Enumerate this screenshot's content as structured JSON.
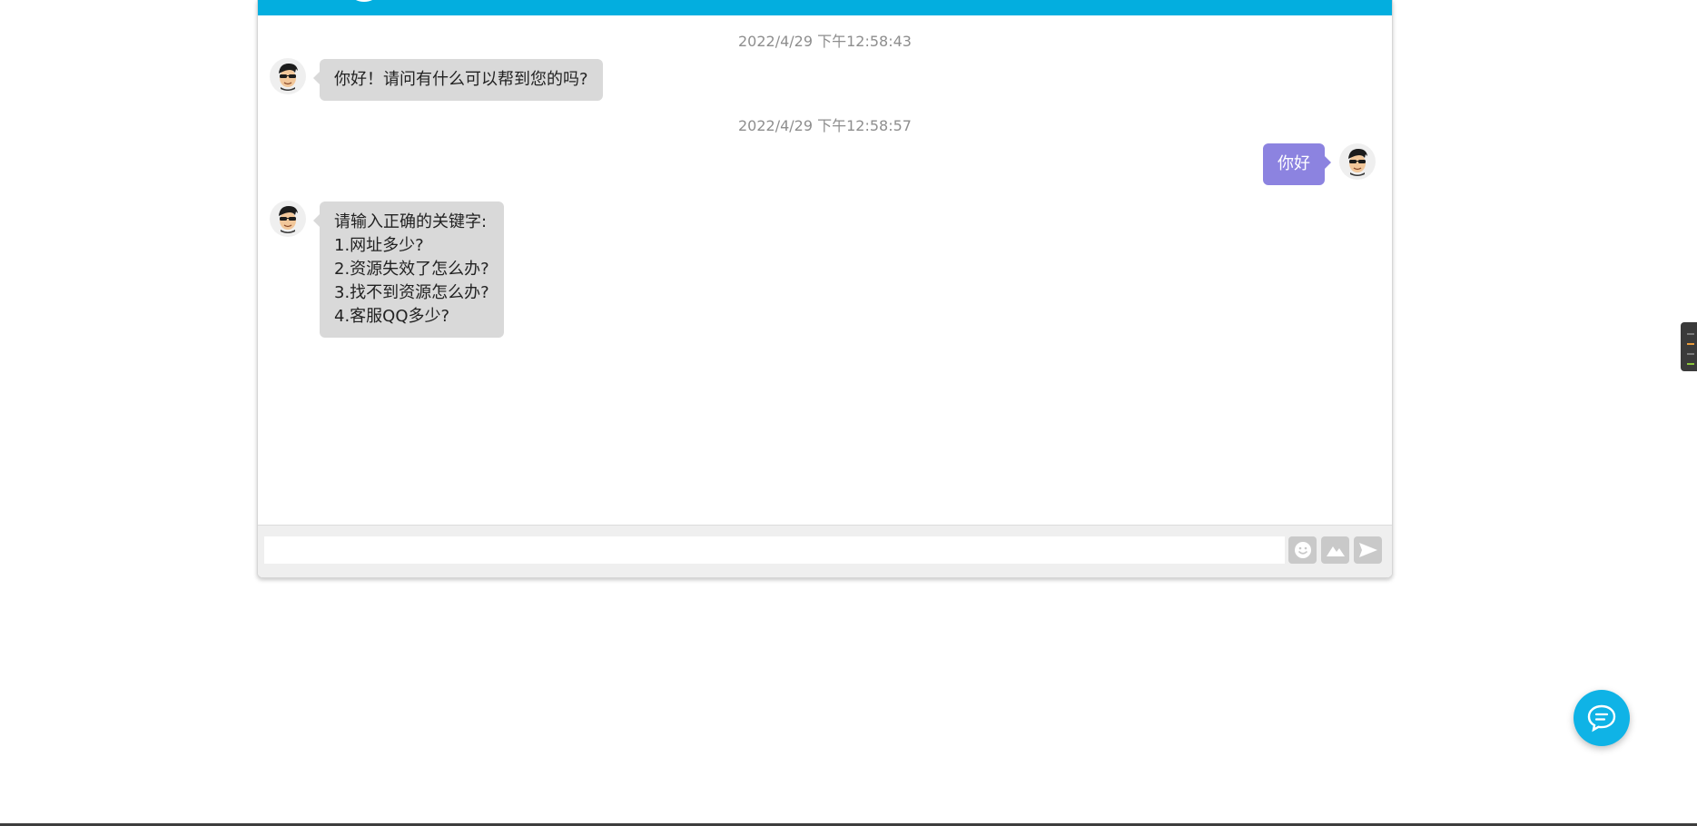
{
  "messages": [
    {
      "timestamp": "2022/4/29 下午12:58:43",
      "sender": "bot",
      "text": "你好！请问有什么可以帮到您的吗?"
    },
    {
      "timestamp": "2022/4/29 下午12:58:57",
      "sender": "user",
      "text": "你好"
    },
    {
      "sender": "bot",
      "text": "请输入正确的关键字:\n1.网址多少?\n2.资源失效了怎么办?\n3.找不到资源怎么办?\n4.客服QQ多少?"
    }
  ],
  "input": {
    "value": "",
    "placeholder": ""
  },
  "toolbar": {
    "emoji_icon": "smiley-icon",
    "image_icon": "image-icon",
    "send_icon": "send-icon"
  },
  "colors": {
    "header": "#03aedf",
    "bot_bubble": "#d9d9d9",
    "user_bubble": "#8c83e0",
    "fab": "#0fb3e6",
    "toolbar_button": "#c9c9c9"
  }
}
